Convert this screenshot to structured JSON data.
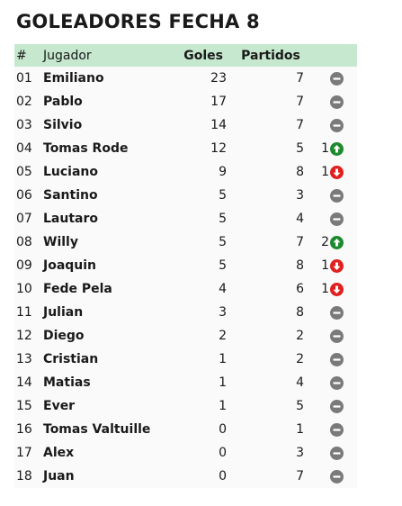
{
  "title": "GOLEADORES FECHA 8",
  "headers": {
    "pos": "#",
    "player": "Jugador",
    "goals": "Goles",
    "matches": "Partidos"
  },
  "colors": {
    "header_bg": "#c6e8cf",
    "same": "#7a7a7a",
    "up": "#1e8a2f",
    "down": "#e0201e"
  },
  "rows": [
    {
      "pos": "01",
      "name": "Emiliano",
      "goals": "23",
      "matches": "7",
      "change": "",
      "trend": "same",
      "icon": "dash-circle-icon"
    },
    {
      "pos": "02",
      "name": "Pablo",
      "goals": "17",
      "matches": "7",
      "change": "",
      "trend": "same",
      "icon": "dash-circle-icon"
    },
    {
      "pos": "03",
      "name": "Silvio",
      "goals": "14",
      "matches": "7",
      "change": "",
      "trend": "same",
      "icon": "dash-circle-icon"
    },
    {
      "pos": "04",
      "name": "Tomas Rode",
      "goals": "12",
      "matches": "5",
      "change": "1",
      "trend": "up",
      "icon": "arrow-up-circle-icon"
    },
    {
      "pos": "05",
      "name": "Luciano",
      "goals": "9",
      "matches": "8",
      "change": "1",
      "trend": "down",
      "icon": "arrow-down-circle-icon"
    },
    {
      "pos": "06",
      "name": "Santino",
      "goals": "5",
      "matches": "3",
      "change": "",
      "trend": "same",
      "icon": "dash-circle-icon"
    },
    {
      "pos": "07",
      "name": "Lautaro",
      "goals": "5",
      "matches": "4",
      "change": "",
      "trend": "same",
      "icon": "dash-circle-icon"
    },
    {
      "pos": "08",
      "name": "Willy",
      "goals": "5",
      "matches": "7",
      "change": "2",
      "trend": "up",
      "icon": "arrow-up-circle-icon"
    },
    {
      "pos": "09",
      "name": "Joaquin",
      "goals": "5",
      "matches": "8",
      "change": "1",
      "trend": "down",
      "icon": "arrow-down-circle-icon"
    },
    {
      "pos": "10",
      "name": "Fede Pela",
      "goals": "4",
      "matches": "6",
      "change": "1",
      "trend": "down",
      "icon": "arrow-down-circle-icon"
    },
    {
      "pos": "11",
      "name": "Julian",
      "goals": "3",
      "matches": "8",
      "change": "",
      "trend": "same",
      "icon": "dash-circle-icon"
    },
    {
      "pos": "12",
      "name": "Diego",
      "goals": "2",
      "matches": "2",
      "change": "",
      "trend": "same",
      "icon": "dash-circle-icon"
    },
    {
      "pos": "13",
      "name": "Cristian",
      "goals": "1",
      "matches": "2",
      "change": "",
      "trend": "same",
      "icon": "dash-circle-icon"
    },
    {
      "pos": "14",
      "name": "Matias",
      "goals": "1",
      "matches": "4",
      "change": "",
      "trend": "same",
      "icon": "dash-circle-icon"
    },
    {
      "pos": "15",
      "name": "Ever",
      "goals": "1",
      "matches": "5",
      "change": "",
      "trend": "same",
      "icon": "dash-circle-icon"
    },
    {
      "pos": "16",
      "name": "Tomas Valtuille",
      "goals": "0",
      "matches": "1",
      "change": "",
      "trend": "same",
      "icon": "dash-circle-icon"
    },
    {
      "pos": "17",
      "name": "Alex",
      "goals": "0",
      "matches": "3",
      "change": "",
      "trend": "same",
      "icon": "dash-circle-icon"
    },
    {
      "pos": "18",
      "name": "Juan",
      "goals": "0",
      "matches": "7",
      "change": "",
      "trend": "same",
      "icon": "dash-circle-icon"
    }
  ]
}
